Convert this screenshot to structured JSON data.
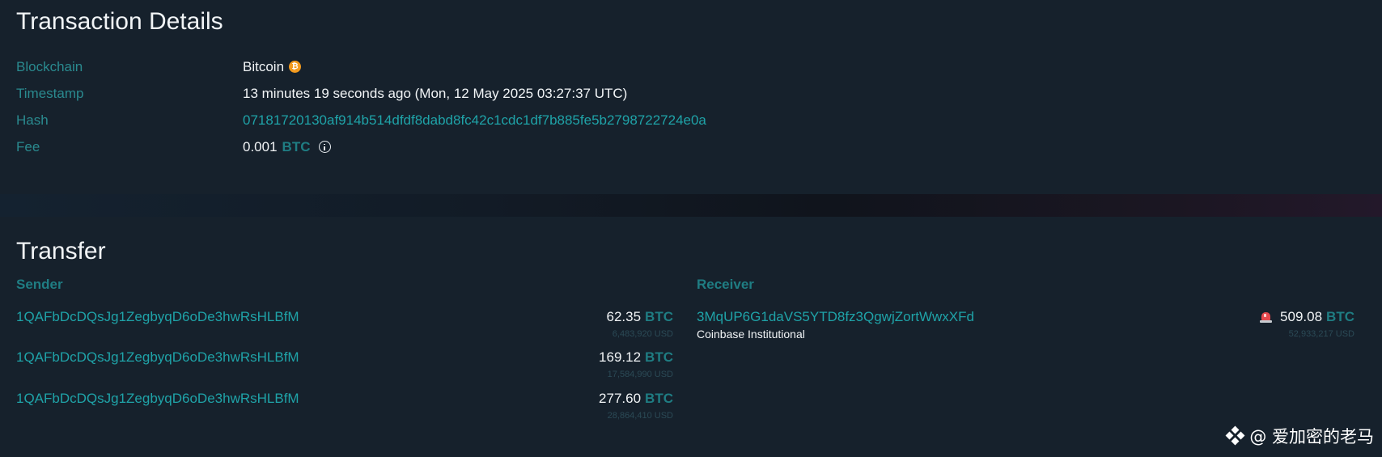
{
  "details": {
    "title": "Transaction Details",
    "blockchain_label": "Blockchain",
    "blockchain_value": "Bitcoin",
    "timestamp_label": "Timestamp",
    "timestamp_value": "13 minutes 19 seconds ago (Mon, 12 May 2025 03:27:37 UTC)",
    "hash_label": "Hash",
    "hash_value": "07181720130af914b514dfdf8dabd8fc42c1cdc1df7b885fe5b2798722724e0a",
    "fee_label": "Fee",
    "fee_amount": "0.001",
    "fee_unit": "BTC",
    "btc_icon": "bitcoin-icon",
    "btc_icon_glyph": "₿"
  },
  "transfer": {
    "title": "Transfer",
    "sender_label": "Sender",
    "receiver_label": "Receiver",
    "senders": [
      {
        "address": "1QAFbDcDQsJg1ZegbyqD6oDe3hwRsHLBfM",
        "amount": "62.35",
        "unit": "BTC",
        "usd": "6,483,920 USD"
      },
      {
        "address": "1QAFbDcDQsJg1ZegbyqD6oDe3hwRsHLBfM",
        "amount": "169.12",
        "unit": "BTC",
        "usd": "17,584,990 USD"
      },
      {
        "address": "1QAFbDcDQsJg1ZegbyqD6oDe3hwRsHLBfM",
        "amount": "277.60",
        "unit": "BTC",
        "usd": "28,864,410 USD"
      }
    ],
    "receivers": [
      {
        "address": "3MqUP6G1daVS5YTD8fz3QgwjZortWwxXFd",
        "entity": "Coinbase Institutional",
        "amount": "509.08",
        "unit": "BTC",
        "usd": "52,933,217 USD",
        "icon": "alert-siren-icon"
      }
    ]
  },
  "watermark": {
    "text": "@ 爱加密的老马"
  },
  "colors": {
    "background": "#16212c",
    "label": "#2a8a8f",
    "link": "#1fa3a8",
    "unit": "#1f7d83",
    "bitcoin": "#f39a1e",
    "alert": "#e5484d"
  }
}
